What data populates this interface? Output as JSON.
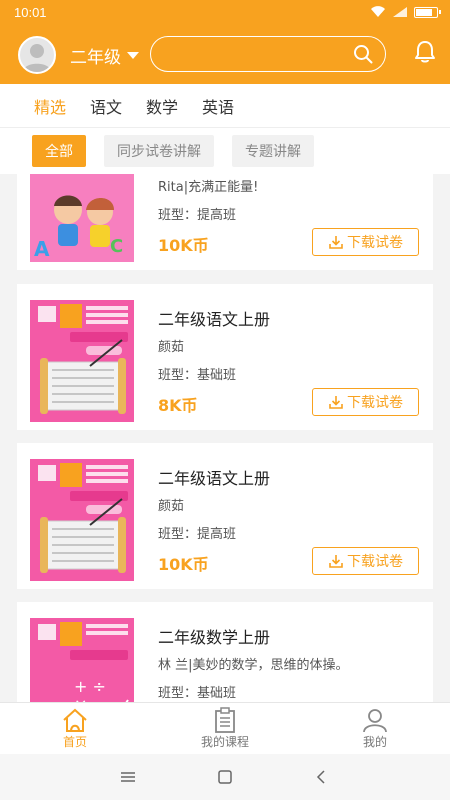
{
  "status": {
    "time": "10:01"
  },
  "header": {
    "grade": "二年级",
    "search_placeholder": ""
  },
  "tabs": [
    {
      "label": "精选",
      "active": true
    },
    {
      "label": "语文"
    },
    {
      "label": "数学"
    },
    {
      "label": "英语"
    }
  ],
  "filters": [
    {
      "label": "全部",
      "active": true
    },
    {
      "label": "同步试卷讲解"
    },
    {
      "label": "专题讲解"
    }
  ],
  "cards": [
    {
      "title": "",
      "author": "Rita|充满正能量!",
      "type": "班型：提高班",
      "price": "10K币",
      "download": "下载试卷",
      "cover": "english"
    },
    {
      "title": "二年级语文上册",
      "author": "颜茹",
      "type": "班型：基础班",
      "price": "8K币",
      "download": "下载试卷",
      "cover": "chinese"
    },
    {
      "title": "二年级语文上册",
      "author": "颜茹",
      "type": "班型：提高班",
      "price": "10K币",
      "download": "下载试卷",
      "cover": "chinese"
    },
    {
      "title": "二年级数学上册",
      "author": "林 兰|美妙的数学，思维的体操。",
      "type": "班型：基础班",
      "price": "",
      "download": "",
      "cover": "math"
    }
  ],
  "bottom_nav": [
    {
      "label": "首页",
      "icon": "home-icon",
      "active": true
    },
    {
      "label": "我的课程",
      "icon": "clipboard-icon"
    },
    {
      "label": "我的",
      "icon": "person-icon"
    }
  ],
  "colors": {
    "accent": "#f8a21f",
    "cover_pink": "#f35aa6"
  }
}
